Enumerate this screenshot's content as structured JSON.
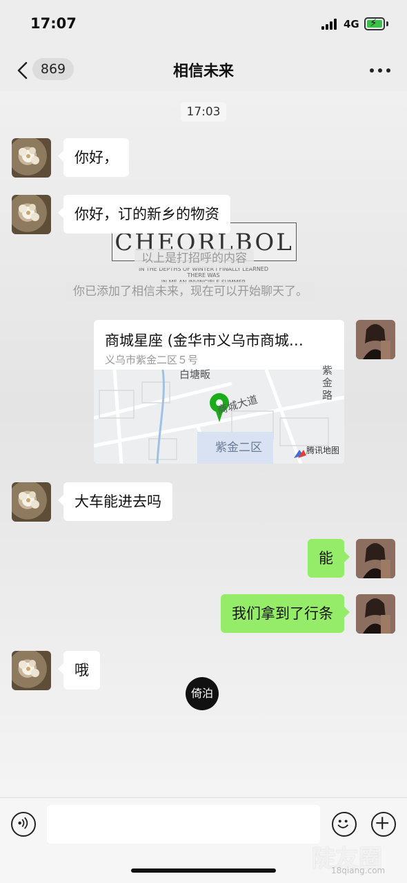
{
  "status_bar": {
    "time": "17:07",
    "network": "4G"
  },
  "header": {
    "unread_count": "869",
    "title": "相信未来"
  },
  "chat": {
    "timestamp": "17:03",
    "watermark_brand": "CHEORLBOL",
    "watermark_line1": "IN THE DEPTHS OF WINTER I FINALLY LEARNED THERE WAS",
    "watermark_line2": "IN ME AN INVINCIBLE SUMMER",
    "system_greeting_note": "以上是打招呼的内容",
    "system_added_note": "你已添加了相信未来，现在可以开始聊天了。",
    "messages": [
      {
        "side": "in",
        "text": "你好，"
      },
      {
        "side": "in",
        "text": "你好，订的新乡的物资"
      },
      {
        "side": "in",
        "text": "大车能进去吗"
      },
      {
        "side": "out",
        "text": "能"
      },
      {
        "side": "out",
        "text": "我们拿到了行条"
      },
      {
        "side": "in",
        "text": "哦"
      }
    ],
    "location": {
      "title": "商城星座 (金华市义乌市商城…",
      "address": "义乌市紫金二区５号",
      "map_labels": {
        "baitang": "白塘畈",
        "road_east": "紫金路",
        "road_main": "商城大道",
        "district": "紫金二区",
        "provider": "腾讯地图"
      }
    },
    "stamp_text": "倚泊"
  },
  "footer": {
    "watermark": "陡友圈",
    "watermark_url": "18qiang.com"
  }
}
